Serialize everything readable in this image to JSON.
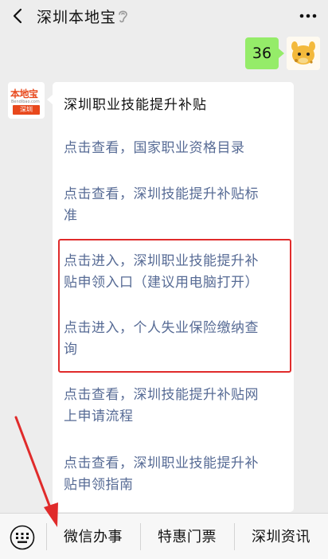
{
  "header": {
    "title": "深圳本地宝",
    "back_icon": "chevron-left-icon",
    "ear_icon": "ear-icon",
    "more_icon": "more-icon"
  },
  "outgoing": {
    "text": "36"
  },
  "bot": {
    "logo_top": "本地宝",
    "logo_mid": "Bendibao.com",
    "logo_bottom": "深圳"
  },
  "card": {
    "title": "深圳职业技能提升补贴",
    "links": [
      {
        "line1": "点击查看，国家职业资格目录",
        "line2": ""
      },
      {
        "line1": "点击查看，深圳技能提升补贴标",
        "line2": "准"
      },
      {
        "line1": "点击进入，深圳职业技能提升补",
        "line2": "贴申领入口（建议用电脑打开）"
      },
      {
        "line1": "点击进入，个人失业保险缴纳查",
        "line2": "询"
      },
      {
        "line1": "点击查看，深圳技能提升补贴网",
        "line2": "上申请流程"
      },
      {
        "line1": "点击查看，深圳职业技能提升补",
        "line2": "贴申领指南"
      }
    ]
  },
  "annotation": {
    "highlight_color": "#e02b2b"
  },
  "menu": {
    "items": [
      "微信办事",
      "特惠门票",
      "深圳资讯"
    ],
    "keyboard_icon": "keyboard-icon"
  },
  "colors": {
    "link": "#576b95",
    "bubble": "#95ec69",
    "background": "#ededed"
  }
}
